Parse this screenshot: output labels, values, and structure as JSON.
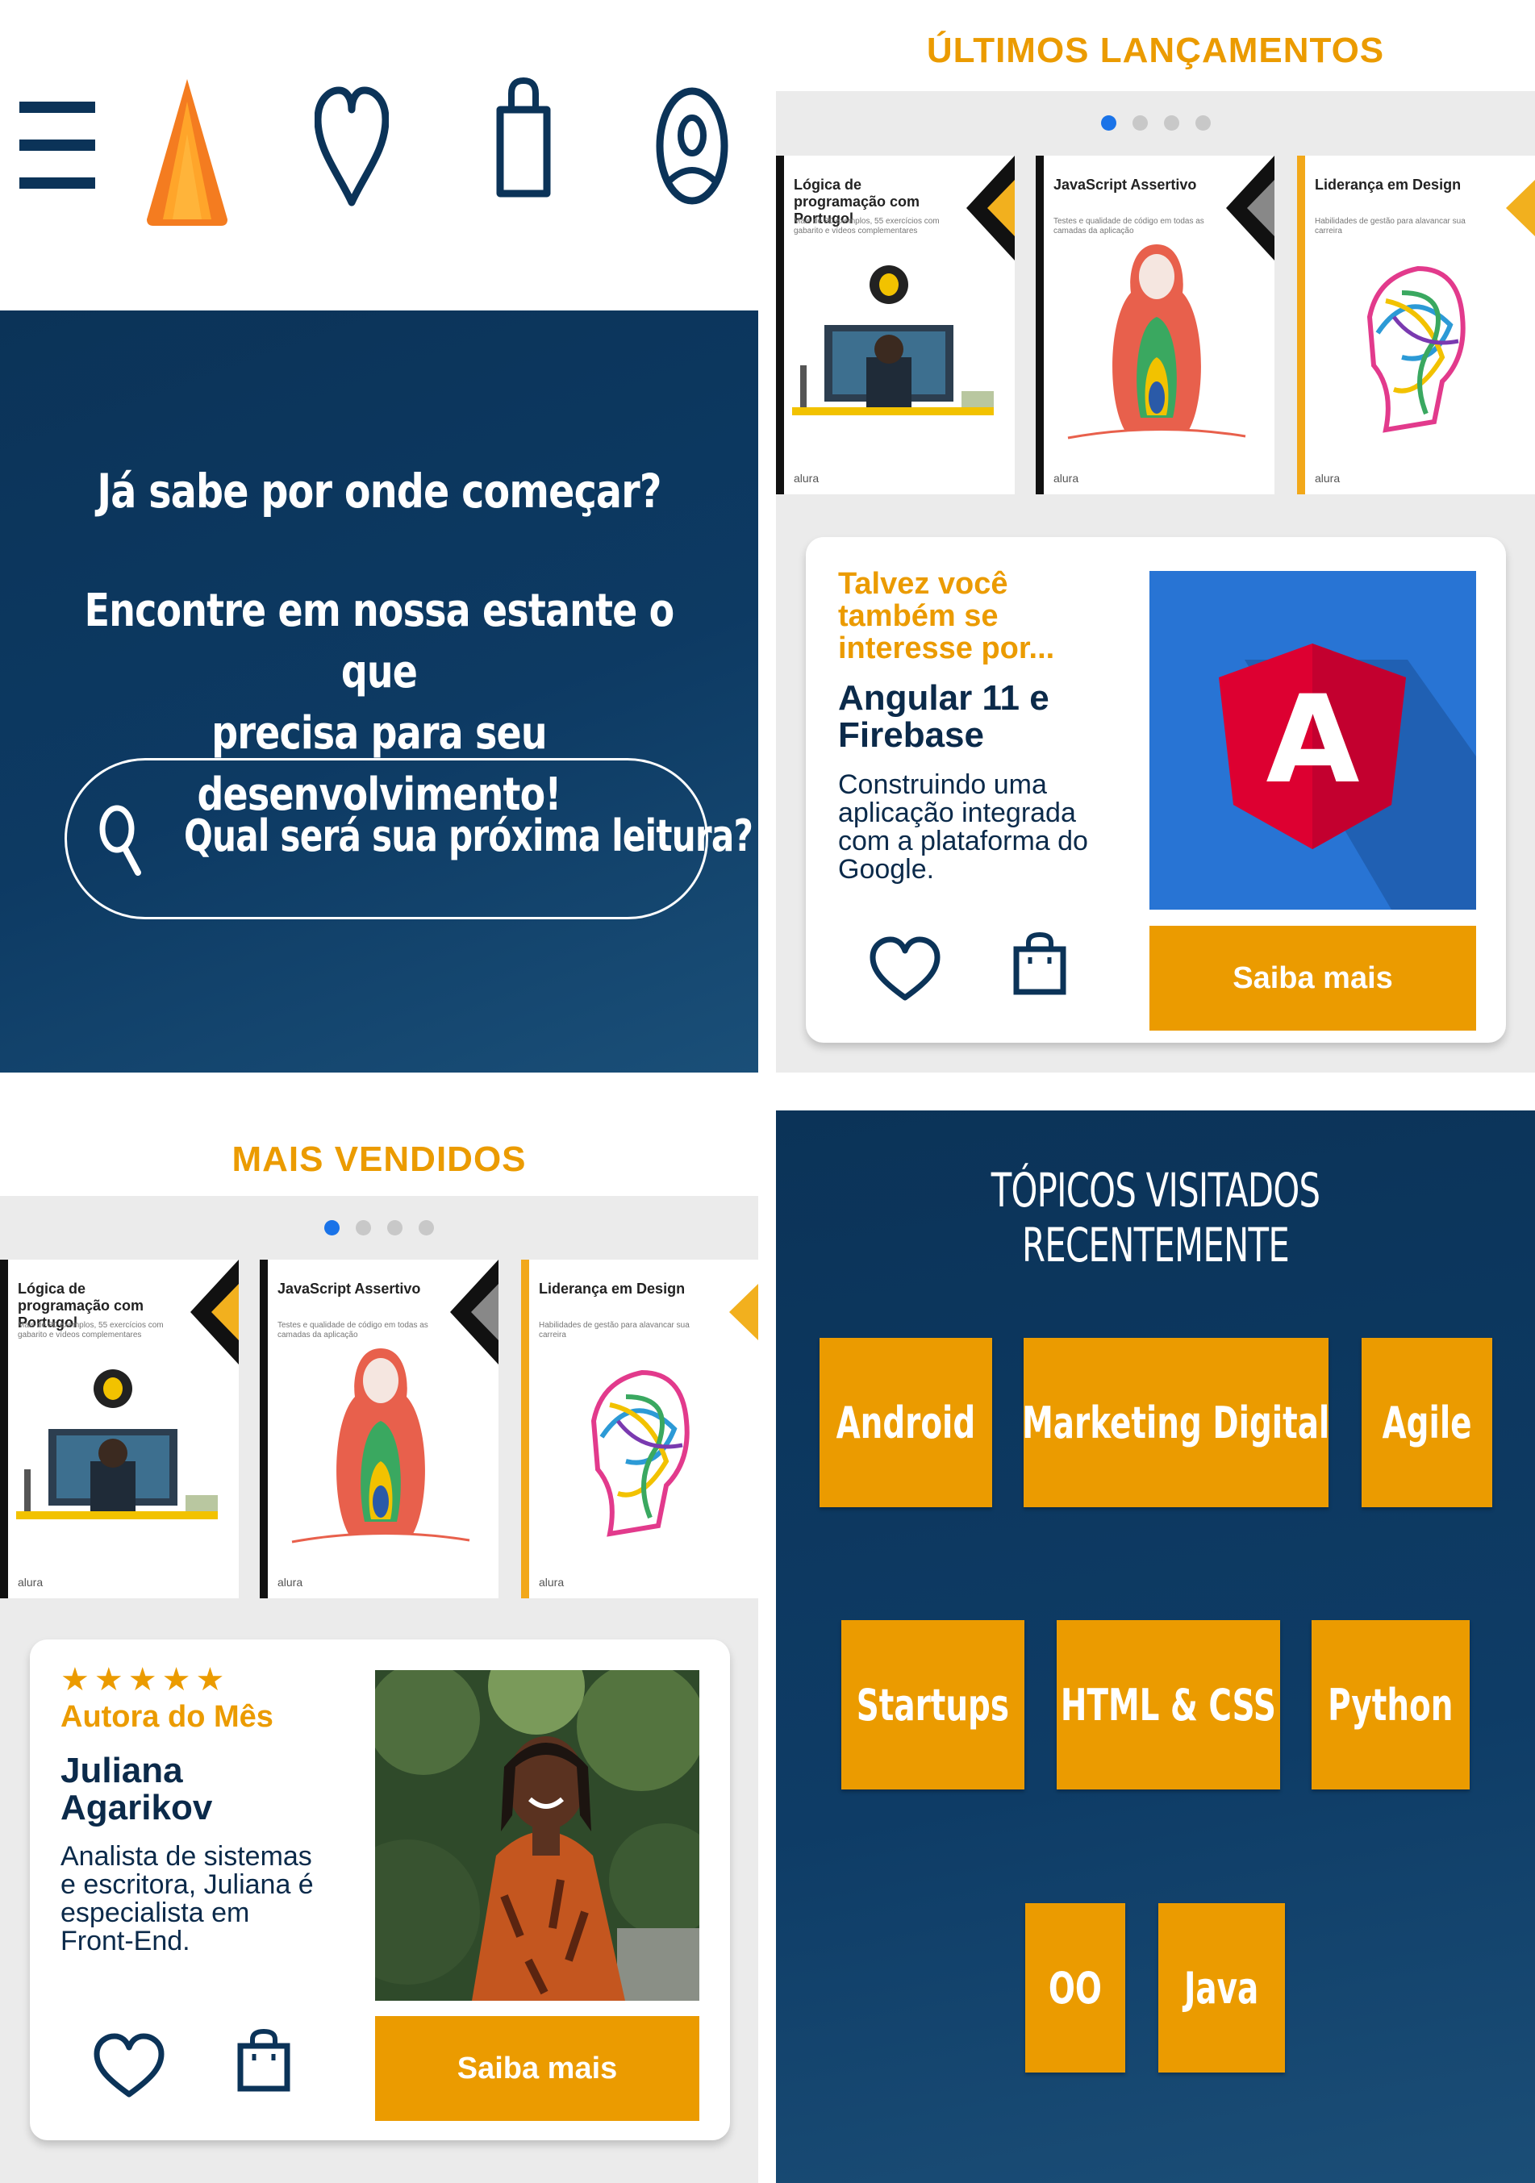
{
  "header": {
    "menu_icon": "hamburger-menu-icon",
    "logo_icon": "orange-triangle-logo",
    "favorites_icon": "heart-icon",
    "bag_icon": "shopping-bag-icon",
    "profile_icon": "user-profile-icon"
  },
  "hero": {
    "title": "Já sabe por onde começar?",
    "subtitle_line1": "Encontre em nossa estante o que",
    "subtitle_line2": "precisa para seu desenvolvimento!",
    "search_placeholder": "Qual será sua próxima leitura?"
  },
  "launches": {
    "heading": "ÚLTIMOS LANÇAMENTOS",
    "dots": 4,
    "active_dot": 0,
    "books": [
      {
        "title": "Lógica de programação com Portugol",
        "subtitle": "Mais de 80 exemplos, 55 exercícios com gabarito e vídeos complementares",
        "publisher": "alura"
      },
      {
        "title": "JavaScript Assertivo",
        "subtitle": "Testes e qualidade de código em todas as camadas da aplicação",
        "publisher": "alura"
      },
      {
        "title": "Liderança em Design",
        "subtitle": "Habilidades de gestão para alavancar sua carreira",
        "publisher": "alura"
      }
    ]
  },
  "suggestion_card": {
    "kicker_line1": "Talvez você",
    "kicker_line2": "também se",
    "kicker_line3": "interesse por...",
    "title_line1": "Angular 11 e",
    "title_line2": "Firebase",
    "desc_line1": "Construindo uma",
    "desc_line2": "aplicação integrada",
    "desc_line3": "com a plataforma do",
    "desc_line4": "Google.",
    "button": "Saiba mais",
    "image_letter": "A",
    "colors": {
      "image_bg": "#2874d4",
      "shield": "#dd0031"
    }
  },
  "bestsellers": {
    "heading": "MAIS VENDIDOS",
    "dots": 4,
    "active_dot": 0
  },
  "author_card": {
    "stars": "★★★★★",
    "kicker": "Autora do Mês",
    "name_line1": "Juliana",
    "name_line2": "Agarikov",
    "desc_line1": "Analista de sistemas",
    "desc_line2": "e escritora, Juliana é",
    "desc_line3": "especialista em",
    "desc_line4": "Front-End.",
    "button": "Saiba mais"
  },
  "topics": {
    "heading": "TÓPICOS VISITADOS RECENTEMENTE",
    "items": [
      "Android",
      "Marketing Digital",
      "Agile",
      "Startups",
      "HTML & CSS",
      "Python",
      "OO",
      "Java"
    ]
  },
  "colors": {
    "accent": "#eb9b00",
    "navy": "#0b3358",
    "active_dot": "#1a73e8"
  }
}
